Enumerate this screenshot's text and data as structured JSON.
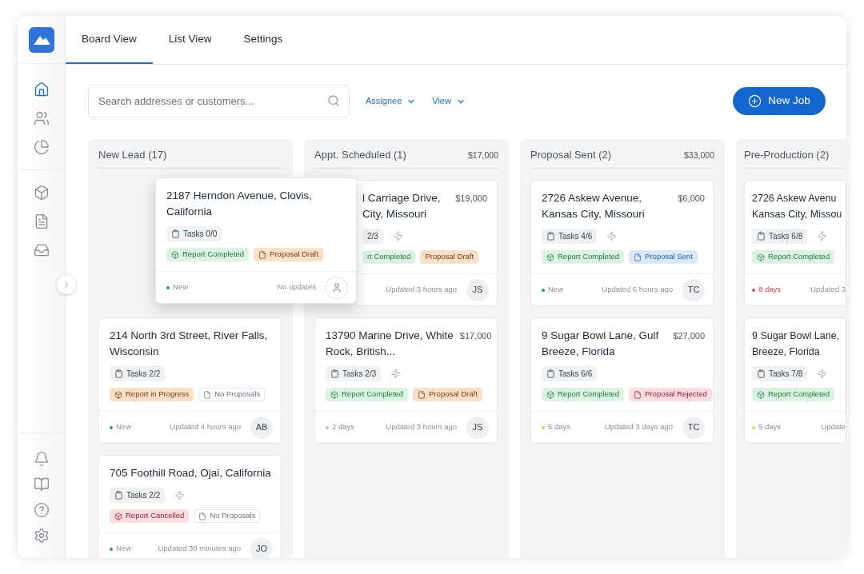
{
  "tabs": [
    {
      "label": "Board View",
      "selected": true
    },
    {
      "label": "List View",
      "selected": false
    },
    {
      "label": "Settings",
      "selected": false
    }
  ],
  "sidebar": {
    "items": [
      {
        "kind": "home",
        "selected": true
      },
      {
        "kind": "users",
        "selected": false
      },
      {
        "kind": "pie",
        "selected": false
      },
      {
        "kind": "box",
        "selected": false
      },
      {
        "kind": "file",
        "selected": false
      },
      {
        "kind": "inbox",
        "selected": false
      }
    ],
    "bottom_items": [
      {
        "kind": "bell"
      },
      {
        "kind": "book"
      },
      {
        "kind": "help"
      },
      {
        "kind": "gear"
      }
    ]
  },
  "search": {
    "placeholder": "Search addresses or customers..."
  },
  "filters": [
    {
      "label": "Assignee"
    },
    {
      "label": "View"
    }
  ],
  "new_button": {
    "label": "New Job"
  },
  "dragged_card": {
    "title_lines": [
      "2187 Herndon Avenue, Clovis,",
      "California"
    ],
    "tasks": "Tasks 0/0",
    "bolt": false,
    "tags": [
      {
        "kind": "report",
        "color": "#dcf3e3",
        "label": "Report Completed"
      },
      {
        "kind": "proposal",
        "color": "#fbe0c8",
        "label": "Proposal Draft"
      }
    ],
    "status": {
      "label": "New",
      "color": "#22a05a",
      "overdue": false
    },
    "updated": "No updates"
  },
  "columns": [
    {
      "title": "New Lead (17)",
      "cards": [
        {
          "title_lines": [
            "214 North 3rd Street, River Falls,",
            "Wisconsin"
          ],
          "tasks": "Tasks 2/2",
          "bolt": false,
          "tags": [
            {
              "kind": "report",
              "color": "#fbe0c8",
              "label": "Report in Progress"
            },
            {
              "kind": "proposal",
              "color": "#ffffff",
              "label": "No Proposals"
            }
          ],
          "status": {
            "label": "New",
            "color": "#22a05a",
            "overdue": false
          },
          "updated": "Updated 4 hours ago",
          "avatar": "AB"
        },
        {
          "title_lines": [
            "705 Foothill Road, Ojai, California"
          ],
          "tasks": "Tasks 2/2",
          "bolt": true,
          "tags": [
            {
              "kind": "report",
              "color": "#fbdde0",
              "label": "Report Cancelled"
            },
            {
              "kind": "proposal",
              "color": "#ffffff",
              "label": "No Proposals"
            }
          ],
          "status": {
            "label": "New",
            "color": "#22a05a",
            "overdue": false
          },
          "updated": "Updated 30 minutes ago",
          "avatar": "JO"
        }
      ]
    },
    {
      "title": "Appt. Scheduled (1)",
      "total": "$17,000",
      "cards": [
        {
          "covered": true,
          "title_lines": [
            "l Carriage Drive,",
            "City, Missouri"
          ],
          "amount": "$19,000",
          "tasks": "2/3",
          "bolt": true,
          "tags": [
            {
              "kind": "report",
              "color": "#dcf3e3",
              "label": "rt Completed"
            },
            {
              "kind": "proposal",
              "color": "#fbe0c8",
              "label": "Proposal Draft"
            }
          ],
          "updated": "Updated 3 hours ago",
          "avatar": "JS"
        },
        {
          "covered": false,
          "title_lines": [
            "13790 Marine Drive, White",
            "Rock, British..."
          ],
          "amount": "$17,000",
          "tasks": "Tasks 2/3",
          "bolt": true,
          "tags": [
            {
              "kind": "report",
              "color": "#dcf3e3",
              "label": "Report Completed"
            },
            {
              "kind": "proposal",
              "color": "#fbe0c8",
              "label": "Proposal Draft"
            }
          ],
          "status": {
            "label": "2 days",
            "color": "#b8bcc2",
            "overdue": false
          },
          "updated": "Updated 3 hours ago",
          "avatar": "JS"
        }
      ]
    },
    {
      "title": "Proposal Sent (2)",
      "total": "$33,000",
      "cards": [
        {
          "title_lines": [
            "2726 Askew Avenue,",
            "Kansas City, Missouri"
          ],
          "amount": "$6,000",
          "tasks": "Tasks 4/6",
          "bolt": true,
          "tags": [
            {
              "kind": "report",
              "color": "#dcf3e3",
              "label": "Report Completed"
            },
            {
              "kind": "proposal",
              "color": "#dbe8fb",
              "label": "Proposal Sent"
            }
          ],
          "status": {
            "label": "New",
            "color": "#22a05a",
            "overdue": false
          },
          "updated": "Updated 6 hours ago",
          "avatar": "TC"
        },
        {
          "title_lines": [
            "9 Sugar Bowl Lane, Gulf",
            "Breeze, Florida"
          ],
          "amount": "$27,000",
          "tasks": "Tasks 6/6",
          "bolt": false,
          "tags": [
            {
              "kind": "report",
              "color": "#dcf3e3",
              "label": "Report Completed"
            },
            {
              "kind": "proposal",
              "color": "#fbdde0",
              "label": "Proposal Rejected"
            }
          ],
          "status": {
            "label": "5 days",
            "color": "#f2c14e",
            "overdue": false
          },
          "updated": "Updated 3 days ago",
          "avatar": "TC"
        }
      ]
    },
    {
      "title": "Pre-Production (2)",
      "cards": [
        {
          "title_lines": [
            "2726 Askew Avenu",
            "Kansas City, Missou"
          ],
          "tasks": "Tasks 6/8",
          "bolt": true,
          "tags": [
            {
              "kind": "report",
              "color": "#dcf3e3",
              "label": "Report Completed"
            }
          ],
          "status": {
            "label": "8 days",
            "color": "#e0455a",
            "overdue": true
          },
          "updated": "Updated 3"
        },
        {
          "title_lines": [
            "9 Sugar Bowl Lane,",
            "Breeze, Florida"
          ],
          "tasks": "Tasks 7/8",
          "bolt": true,
          "tags": [
            {
              "kind": "report",
              "color": "#dcf3e3",
              "label": "Report Completed"
            }
          ],
          "status": {
            "label": "5 days",
            "color": "#f2c14e",
            "overdue": false
          },
          "updated": "Update"
        }
      ]
    }
  ]
}
